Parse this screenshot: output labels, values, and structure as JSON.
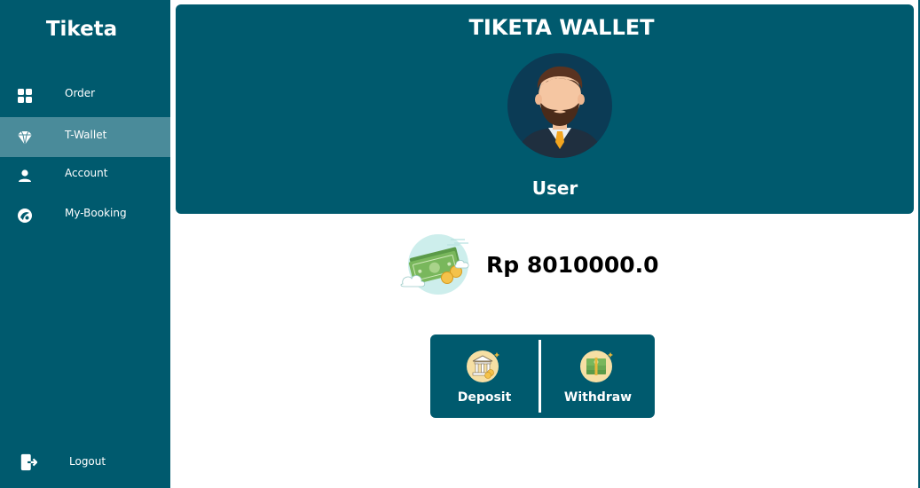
{
  "sidebar": {
    "brand": "Tiketa",
    "items": [
      {
        "label": "Order",
        "icon": "grid-icon"
      },
      {
        "label": "T-Wallet",
        "icon": "diamond-icon",
        "active": true
      },
      {
        "label": "Account",
        "icon": "user-icon"
      },
      {
        "label": "My-Booking",
        "icon": "booking-icon"
      }
    ],
    "logout_label": "Logout",
    "logout_icon": "logout-icon"
  },
  "wallet": {
    "title": "TIKETA WALLET",
    "user_name": "User",
    "balance": "Rp 8010000.0"
  },
  "actions": {
    "deposit_label": "Deposit",
    "withdraw_label": "Withdraw"
  },
  "colors": {
    "primary": "#005a6e",
    "active_item": "#4a8b9a",
    "text_on_primary": "#ffffff"
  }
}
